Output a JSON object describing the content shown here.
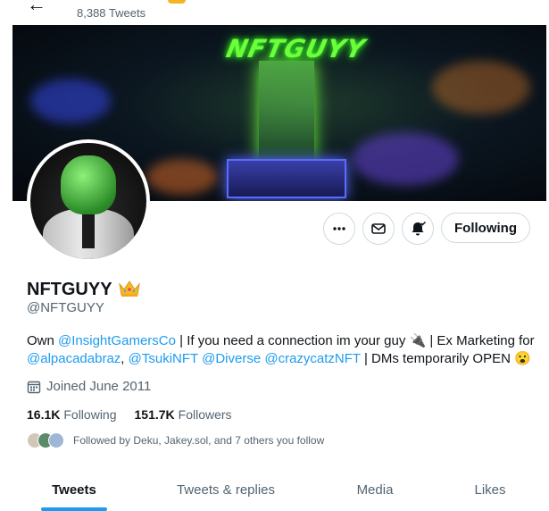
{
  "header": {
    "tweet_count": "8,388 Tweets"
  },
  "profile": {
    "display_name": "NFTGUYY",
    "handle": "@NFTGUYY",
    "bio": {
      "own_prefix": "Own ",
      "mention_insight": "@InsightGamersCo",
      "middle": " | If you need a connection im your guy 🔌 | Ex Marketing for ",
      "mention_alpaca": "@alpacadabraz",
      "sep1": ", ",
      "mention_tsuki": "@TsukiNFT",
      "sep2": " ",
      "mention_diverse": "@Diverse",
      "sep3": " ",
      "mention_crazy": "@crazycatzNFT",
      "suffix": " | DMs temporarily OPEN 😮"
    },
    "joined": "Joined June 2011",
    "following_count": "16.1K",
    "following_label": "Following",
    "followers_count": "151.7K",
    "followers_label": "Followers",
    "followed_by": "Followed by Deku, Jakey.sol, and 7 others you follow"
  },
  "actions": {
    "follow_label": "Following"
  },
  "banner": {
    "logo_text": "NFTGUYY"
  },
  "tabs": [
    {
      "label": "Tweets",
      "active": true
    },
    {
      "label": "Tweets & replies",
      "active": false
    },
    {
      "label": "Media",
      "active": false
    },
    {
      "label": "Likes",
      "active": false
    }
  ],
  "colors": {
    "accent": "#1d9bf0",
    "secondary_text": "#536471",
    "primary_text": "#0f1419",
    "border": "#cfd9de"
  }
}
